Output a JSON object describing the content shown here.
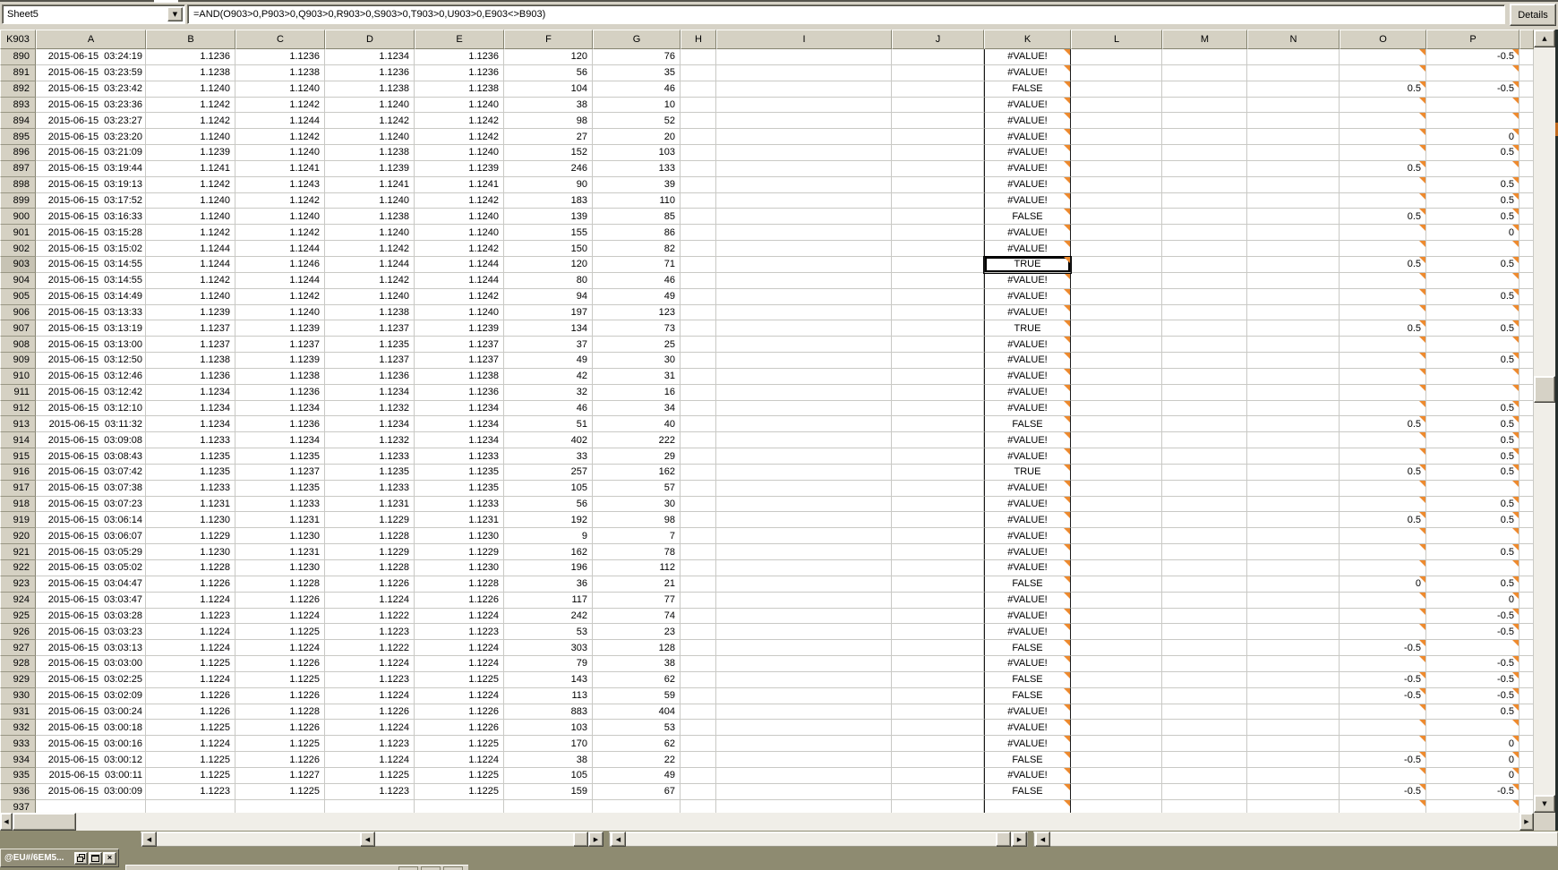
{
  "toolbar": {
    "sheet_selector": "Sheet5",
    "formula": "=AND(O903>0,P903>0,Q903>0,R903>0,S903>0,T903>0,U903>0,E903<>B903)",
    "details_label": "Details"
  },
  "grid": {
    "name_box": "K903",
    "selected_cell": {
      "ref": "K903",
      "value": "TRUE"
    },
    "columns": [
      "A",
      "B",
      "C",
      "D",
      "E",
      "F",
      "G",
      "H",
      "I",
      "J",
      "K",
      "L",
      "M",
      "N",
      "O",
      "P",
      ""
    ],
    "row_fields": [
      "row",
      "A",
      "B",
      "C",
      "D",
      "E",
      "F",
      "G",
      "K",
      "O",
      "P"
    ],
    "rows": [
      [
        "890",
        "2015-06-15  03:24:19",
        "1.1236",
        "1.1236",
        "1.1234",
        "1.1236",
        "120",
        "76",
        "#VALUE!",
        "",
        "-0.5"
      ],
      [
        "891",
        "2015-06-15  03:23:59",
        "1.1238",
        "1.1238",
        "1.1236",
        "1.1236",
        "56",
        "35",
        "#VALUE!",
        "",
        ""
      ],
      [
        "892",
        "2015-06-15  03:23:42",
        "1.1240",
        "1.1240",
        "1.1238",
        "1.1238",
        "104",
        "46",
        "FALSE",
        "0.5",
        "-0.5"
      ],
      [
        "893",
        "2015-06-15  03:23:36",
        "1.1242",
        "1.1242",
        "1.1240",
        "1.1240",
        "38",
        "10",
        "#VALUE!",
        "",
        ""
      ],
      [
        "894",
        "2015-06-15  03:23:27",
        "1.1242",
        "1.1244",
        "1.1242",
        "1.1242",
        "98",
        "52",
        "#VALUE!",
        "",
        ""
      ],
      [
        "895",
        "2015-06-15  03:23:20",
        "1.1240",
        "1.1242",
        "1.1240",
        "1.1242",
        "27",
        "20",
        "#VALUE!",
        "",
        "0"
      ],
      [
        "896",
        "2015-06-15  03:21:09",
        "1.1239",
        "1.1240",
        "1.1238",
        "1.1240",
        "152",
        "103",
        "#VALUE!",
        "",
        "0.5"
      ],
      [
        "897",
        "2015-06-15  03:19:44",
        "1.1241",
        "1.1241",
        "1.1239",
        "1.1239",
        "246",
        "133",
        "#VALUE!",
        "0.5",
        ""
      ],
      [
        "898",
        "2015-06-15  03:19:13",
        "1.1242",
        "1.1243",
        "1.1241",
        "1.1241",
        "90",
        "39",
        "#VALUE!",
        "",
        "0.5"
      ],
      [
        "899",
        "2015-06-15  03:17:52",
        "1.1240",
        "1.1242",
        "1.1240",
        "1.1242",
        "183",
        "110",
        "#VALUE!",
        "",
        "0.5"
      ],
      [
        "900",
        "2015-06-15  03:16:33",
        "1.1240",
        "1.1240",
        "1.1238",
        "1.1240",
        "139",
        "85",
        "FALSE",
        "0.5",
        "0.5"
      ],
      [
        "901",
        "2015-06-15  03:15:28",
        "1.1242",
        "1.1242",
        "1.1240",
        "1.1240",
        "155",
        "86",
        "#VALUE!",
        "",
        "0"
      ],
      [
        "902",
        "2015-06-15  03:15:02",
        "1.1244",
        "1.1244",
        "1.1242",
        "1.1242",
        "150",
        "82",
        "#VALUE!",
        "",
        ""
      ],
      [
        "903",
        "2015-06-15  03:14:55",
        "1.1244",
        "1.1246",
        "1.1244",
        "1.1244",
        "120",
        "71",
        "TRUE",
        "0.5",
        "0.5"
      ],
      [
        "904",
        "2015-06-15  03:14:55",
        "1.1242",
        "1.1244",
        "1.1242",
        "1.1244",
        "80",
        "46",
        "#VALUE!",
        "",
        ""
      ],
      [
        "905",
        "2015-06-15  03:14:49",
        "1.1240",
        "1.1242",
        "1.1240",
        "1.1242",
        "94",
        "49",
        "#VALUE!",
        "",
        "0.5"
      ],
      [
        "906",
        "2015-06-15  03:13:33",
        "1.1239",
        "1.1240",
        "1.1238",
        "1.1240",
        "197",
        "123",
        "#VALUE!",
        "",
        ""
      ],
      [
        "907",
        "2015-06-15  03:13:19",
        "1.1237",
        "1.1239",
        "1.1237",
        "1.1239",
        "134",
        "73",
        "TRUE",
        "0.5",
        "0.5"
      ],
      [
        "908",
        "2015-06-15  03:13:00",
        "1.1237",
        "1.1237",
        "1.1235",
        "1.1237",
        "37",
        "25",
        "#VALUE!",
        "",
        ""
      ],
      [
        "909",
        "2015-06-15  03:12:50",
        "1.1238",
        "1.1239",
        "1.1237",
        "1.1237",
        "49",
        "30",
        "#VALUE!",
        "",
        "0.5"
      ],
      [
        "910",
        "2015-06-15  03:12:46",
        "1.1236",
        "1.1238",
        "1.1236",
        "1.1238",
        "42",
        "31",
        "#VALUE!",
        "",
        ""
      ],
      [
        "911",
        "2015-06-15  03:12:42",
        "1.1234",
        "1.1236",
        "1.1234",
        "1.1236",
        "32",
        "16",
        "#VALUE!",
        "",
        ""
      ],
      [
        "912",
        "2015-06-15  03:12:10",
        "1.1234",
        "1.1234",
        "1.1232",
        "1.1234",
        "46",
        "34",
        "#VALUE!",
        "",
        "0.5"
      ],
      [
        "913",
        "2015-06-15  03:11:32",
        "1.1234",
        "1.1236",
        "1.1234",
        "1.1234",
        "51",
        "40",
        "FALSE",
        "0.5",
        "0.5"
      ],
      [
        "914",
        "2015-06-15  03:09:08",
        "1.1233",
        "1.1234",
        "1.1232",
        "1.1234",
        "402",
        "222",
        "#VALUE!",
        "",
        "0.5"
      ],
      [
        "915",
        "2015-06-15  03:08:43",
        "1.1235",
        "1.1235",
        "1.1233",
        "1.1233",
        "33",
        "29",
        "#VALUE!",
        "",
        "0.5"
      ],
      [
        "916",
        "2015-06-15  03:07:42",
        "1.1235",
        "1.1237",
        "1.1235",
        "1.1235",
        "257",
        "162",
        "TRUE",
        "0.5",
        "0.5"
      ],
      [
        "917",
        "2015-06-15  03:07:38",
        "1.1233",
        "1.1235",
        "1.1233",
        "1.1235",
        "105",
        "57",
        "#VALUE!",
        "",
        ""
      ],
      [
        "918",
        "2015-06-15  03:07:23",
        "1.1231",
        "1.1233",
        "1.1231",
        "1.1233",
        "56",
        "30",
        "#VALUE!",
        "",
        "0.5"
      ],
      [
        "919",
        "2015-06-15  03:06:14",
        "1.1230",
        "1.1231",
        "1.1229",
        "1.1231",
        "192",
        "98",
        "#VALUE!",
        "0.5",
        "0.5"
      ],
      [
        "920",
        "2015-06-15  03:06:07",
        "1.1229",
        "1.1230",
        "1.1228",
        "1.1230",
        "9",
        "7",
        "#VALUE!",
        "",
        ""
      ],
      [
        "921",
        "2015-06-15  03:05:29",
        "1.1230",
        "1.1231",
        "1.1229",
        "1.1229",
        "162",
        "78",
        "#VALUE!",
        "",
        "0.5"
      ],
      [
        "922",
        "2015-06-15  03:05:02",
        "1.1228",
        "1.1230",
        "1.1228",
        "1.1230",
        "196",
        "112",
        "#VALUE!",
        "",
        ""
      ],
      [
        "923",
        "2015-06-15  03:04:47",
        "1.1226",
        "1.1228",
        "1.1226",
        "1.1228",
        "36",
        "21",
        "FALSE",
        "0",
        "0.5"
      ],
      [
        "924",
        "2015-06-15  03:03:47",
        "1.1224",
        "1.1226",
        "1.1224",
        "1.1226",
        "117",
        "77",
        "#VALUE!",
        "",
        "0"
      ],
      [
        "925",
        "2015-06-15  03:03:28",
        "1.1223",
        "1.1224",
        "1.1222",
        "1.1224",
        "242",
        "74",
        "#VALUE!",
        "",
        "-0.5"
      ],
      [
        "926",
        "2015-06-15  03:03:23",
        "1.1224",
        "1.1225",
        "1.1223",
        "1.1223",
        "53",
        "23",
        "#VALUE!",
        "",
        "-0.5"
      ],
      [
        "927",
        "2015-06-15  03:03:13",
        "1.1224",
        "1.1224",
        "1.1222",
        "1.1224",
        "303",
        "128",
        "FALSE",
        "-0.5",
        ""
      ],
      [
        "928",
        "2015-06-15  03:03:00",
        "1.1225",
        "1.1226",
        "1.1224",
        "1.1224",
        "79",
        "38",
        "#VALUE!",
        "",
        "-0.5"
      ],
      [
        "929",
        "2015-06-15  03:02:25",
        "1.1224",
        "1.1225",
        "1.1223",
        "1.1225",
        "143",
        "62",
        "FALSE",
        "-0.5",
        "-0.5"
      ],
      [
        "930",
        "2015-06-15  03:02:09",
        "1.1226",
        "1.1226",
        "1.1224",
        "1.1224",
        "113",
        "59",
        "FALSE",
        "-0.5",
        "-0.5"
      ],
      [
        "931",
        "2015-06-15  03:00:24",
        "1.1226",
        "1.1228",
        "1.1226",
        "1.1226",
        "883",
        "404",
        "#VALUE!",
        "",
        "0.5"
      ],
      [
        "932",
        "2015-06-15  03:00:18",
        "1.1225",
        "1.1226",
        "1.1224",
        "1.1226",
        "103",
        "53",
        "#VALUE!",
        "",
        ""
      ],
      [
        "933",
        "2015-06-15  03:00:16",
        "1.1224",
        "1.1225",
        "1.1223",
        "1.1225",
        "170",
        "62",
        "#VALUE!",
        "",
        "0"
      ],
      [
        "934",
        "2015-06-15  03:00:12",
        "1.1225",
        "1.1226",
        "1.1224",
        "1.1224",
        "38",
        "22",
        "FALSE",
        "-0.5",
        "0"
      ],
      [
        "935",
        "2015-06-15  03:00:11",
        "1.1225",
        "1.1227",
        "1.1225",
        "1.1225",
        "105",
        "49",
        "#VALUE!",
        "",
        "0"
      ],
      [
        "936",
        "2015-06-15  03:00:09",
        "1.1223",
        "1.1225",
        "1.1223",
        "1.1225",
        "159",
        "67",
        "FALSE",
        "-0.5",
        "-0.5"
      ],
      [
        "937",
        "",
        "",
        "",
        "",
        "",
        "",
        "",
        "",
        "",
        ""
      ]
    ]
  },
  "taskbar": {
    "min_window_title": "@EU#/6EM5..."
  },
  "colors": {
    "chrome": "#d6d2c6",
    "desktop": "#8e8b71",
    "comment_marker": "#ee8a2e",
    "gridline": "#c9c9c5",
    "selection_border": "#000000"
  }
}
